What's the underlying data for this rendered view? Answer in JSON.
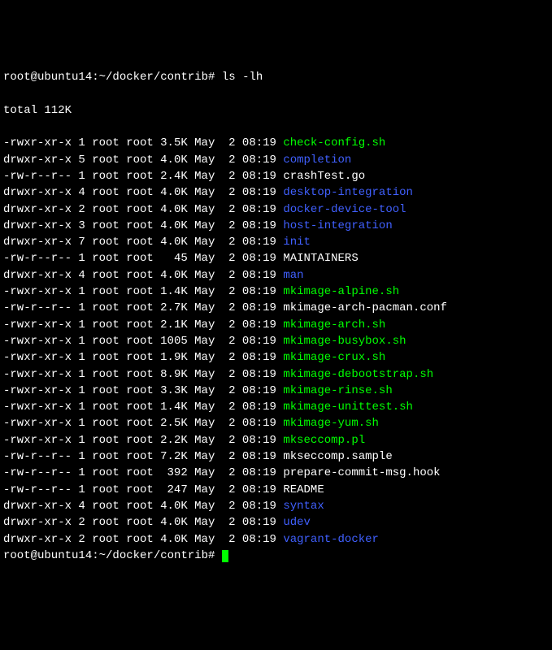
{
  "prompt": {
    "user_host": "root@ubuntu14",
    "sep1": ":",
    "path": "~/docker/contrib",
    "hash": "#",
    "command": "ls -lh"
  },
  "total_line": "total 112K",
  "files": [
    {
      "perms": "-rwxr-xr-x",
      "links": "1",
      "owner": "root",
      "group": "root",
      "size": "3.5K",
      "month": "May",
      "day": "2",
      "time": "08:19",
      "name": "check-config.sh",
      "kind": "exec"
    },
    {
      "perms": "drwxr-xr-x",
      "links": "5",
      "owner": "root",
      "group": "root",
      "size": "4.0K",
      "month": "May",
      "day": "2",
      "time": "08:19",
      "name": "completion",
      "kind": "dir"
    },
    {
      "perms": "-rw-r--r--",
      "links": "1",
      "owner": "root",
      "group": "root",
      "size": "2.4K",
      "month": "May",
      "day": "2",
      "time": "08:19",
      "name": "crashTest.go",
      "kind": "file"
    },
    {
      "perms": "drwxr-xr-x",
      "links": "4",
      "owner": "root",
      "group": "root",
      "size": "4.0K",
      "month": "May",
      "day": "2",
      "time": "08:19",
      "name": "desktop-integration",
      "kind": "dir"
    },
    {
      "perms": "drwxr-xr-x",
      "links": "2",
      "owner": "root",
      "group": "root",
      "size": "4.0K",
      "month": "May",
      "day": "2",
      "time": "08:19",
      "name": "docker-device-tool",
      "kind": "dir"
    },
    {
      "perms": "drwxr-xr-x",
      "links": "3",
      "owner": "root",
      "group": "root",
      "size": "4.0K",
      "month": "May",
      "day": "2",
      "time": "08:19",
      "name": "host-integration",
      "kind": "dir"
    },
    {
      "perms": "drwxr-xr-x",
      "links": "7",
      "owner": "root",
      "group": "root",
      "size": "4.0K",
      "month": "May",
      "day": "2",
      "time": "08:19",
      "name": "init",
      "kind": "dir"
    },
    {
      "perms": "-rw-r--r--",
      "links": "1",
      "owner": "root",
      "group": "root",
      "size": "45",
      "month": "May",
      "day": "2",
      "time": "08:19",
      "name": "MAINTAINERS",
      "kind": "file"
    },
    {
      "perms": "drwxr-xr-x",
      "links": "4",
      "owner": "root",
      "group": "root",
      "size": "4.0K",
      "month": "May",
      "day": "2",
      "time": "08:19",
      "name": "man",
      "kind": "dir"
    },
    {
      "perms": "-rwxr-xr-x",
      "links": "1",
      "owner": "root",
      "group": "root",
      "size": "1.4K",
      "month": "May",
      "day": "2",
      "time": "08:19",
      "name": "mkimage-alpine.sh",
      "kind": "exec"
    },
    {
      "perms": "-rw-r--r--",
      "links": "1",
      "owner": "root",
      "group": "root",
      "size": "2.7K",
      "month": "May",
      "day": "2",
      "time": "08:19",
      "name": "mkimage-arch-pacman.conf",
      "kind": "file"
    },
    {
      "perms": "-rwxr-xr-x",
      "links": "1",
      "owner": "root",
      "group": "root",
      "size": "2.1K",
      "month": "May",
      "day": "2",
      "time": "08:19",
      "name": "mkimage-arch.sh",
      "kind": "exec"
    },
    {
      "perms": "-rwxr-xr-x",
      "links": "1",
      "owner": "root",
      "group": "root",
      "size": "1005",
      "month": "May",
      "day": "2",
      "time": "08:19",
      "name": "mkimage-busybox.sh",
      "kind": "exec"
    },
    {
      "perms": "-rwxr-xr-x",
      "links": "1",
      "owner": "root",
      "group": "root",
      "size": "1.9K",
      "month": "May",
      "day": "2",
      "time": "08:19",
      "name": "mkimage-crux.sh",
      "kind": "exec"
    },
    {
      "perms": "-rwxr-xr-x",
      "links": "1",
      "owner": "root",
      "group": "root",
      "size": "8.9K",
      "month": "May",
      "day": "2",
      "time": "08:19",
      "name": "mkimage-debootstrap.sh",
      "kind": "exec"
    },
    {
      "perms": "-rwxr-xr-x",
      "links": "1",
      "owner": "root",
      "group": "root",
      "size": "3.3K",
      "month": "May",
      "day": "2",
      "time": "08:19",
      "name": "mkimage-rinse.sh",
      "kind": "exec"
    },
    {
      "perms": "-rwxr-xr-x",
      "links": "1",
      "owner": "root",
      "group": "root",
      "size": "1.4K",
      "month": "May",
      "day": "2",
      "time": "08:19",
      "name": "mkimage-unittest.sh",
      "kind": "exec"
    },
    {
      "perms": "-rwxr-xr-x",
      "links": "1",
      "owner": "root",
      "group": "root",
      "size": "2.5K",
      "month": "May",
      "day": "2",
      "time": "08:19",
      "name": "mkimage-yum.sh",
      "kind": "exec"
    },
    {
      "perms": "-rwxr-xr-x",
      "links": "1",
      "owner": "root",
      "group": "root",
      "size": "2.2K",
      "month": "May",
      "day": "2",
      "time": "08:19",
      "name": "mkseccomp.pl",
      "kind": "exec"
    },
    {
      "perms": "-rw-r--r--",
      "links": "1",
      "owner": "root",
      "group": "root",
      "size": "7.2K",
      "month": "May",
      "day": "2",
      "time": "08:19",
      "name": "mkseccomp.sample",
      "kind": "file"
    },
    {
      "perms": "-rw-r--r--",
      "links": "1",
      "owner": "root",
      "group": "root",
      "size": "392",
      "month": "May",
      "day": "2",
      "time": "08:19",
      "name": "prepare-commit-msg.hook",
      "kind": "file"
    },
    {
      "perms": "-rw-r--r--",
      "links": "1",
      "owner": "root",
      "group": "root",
      "size": "247",
      "month": "May",
      "day": "2",
      "time": "08:19",
      "name": "README",
      "kind": "file"
    },
    {
      "perms": "drwxr-xr-x",
      "links": "4",
      "owner": "root",
      "group": "root",
      "size": "4.0K",
      "month": "May",
      "day": "2",
      "time": "08:19",
      "name": "syntax",
      "kind": "dir"
    },
    {
      "perms": "drwxr-xr-x",
      "links": "2",
      "owner": "root",
      "group": "root",
      "size": "4.0K",
      "month": "May",
      "day": "2",
      "time": "08:19",
      "name": "udev",
      "kind": "dir"
    },
    {
      "perms": "drwxr-xr-x",
      "links": "2",
      "owner": "root",
      "group": "root",
      "size": "4.0K",
      "month": "May",
      "day": "2",
      "time": "08:19",
      "name": "vagrant-docker",
      "kind": "dir"
    }
  ],
  "prompt2": {
    "user_host": "root@ubuntu14",
    "sep1": ":",
    "path": "~/docker/contrib",
    "hash": "#"
  }
}
